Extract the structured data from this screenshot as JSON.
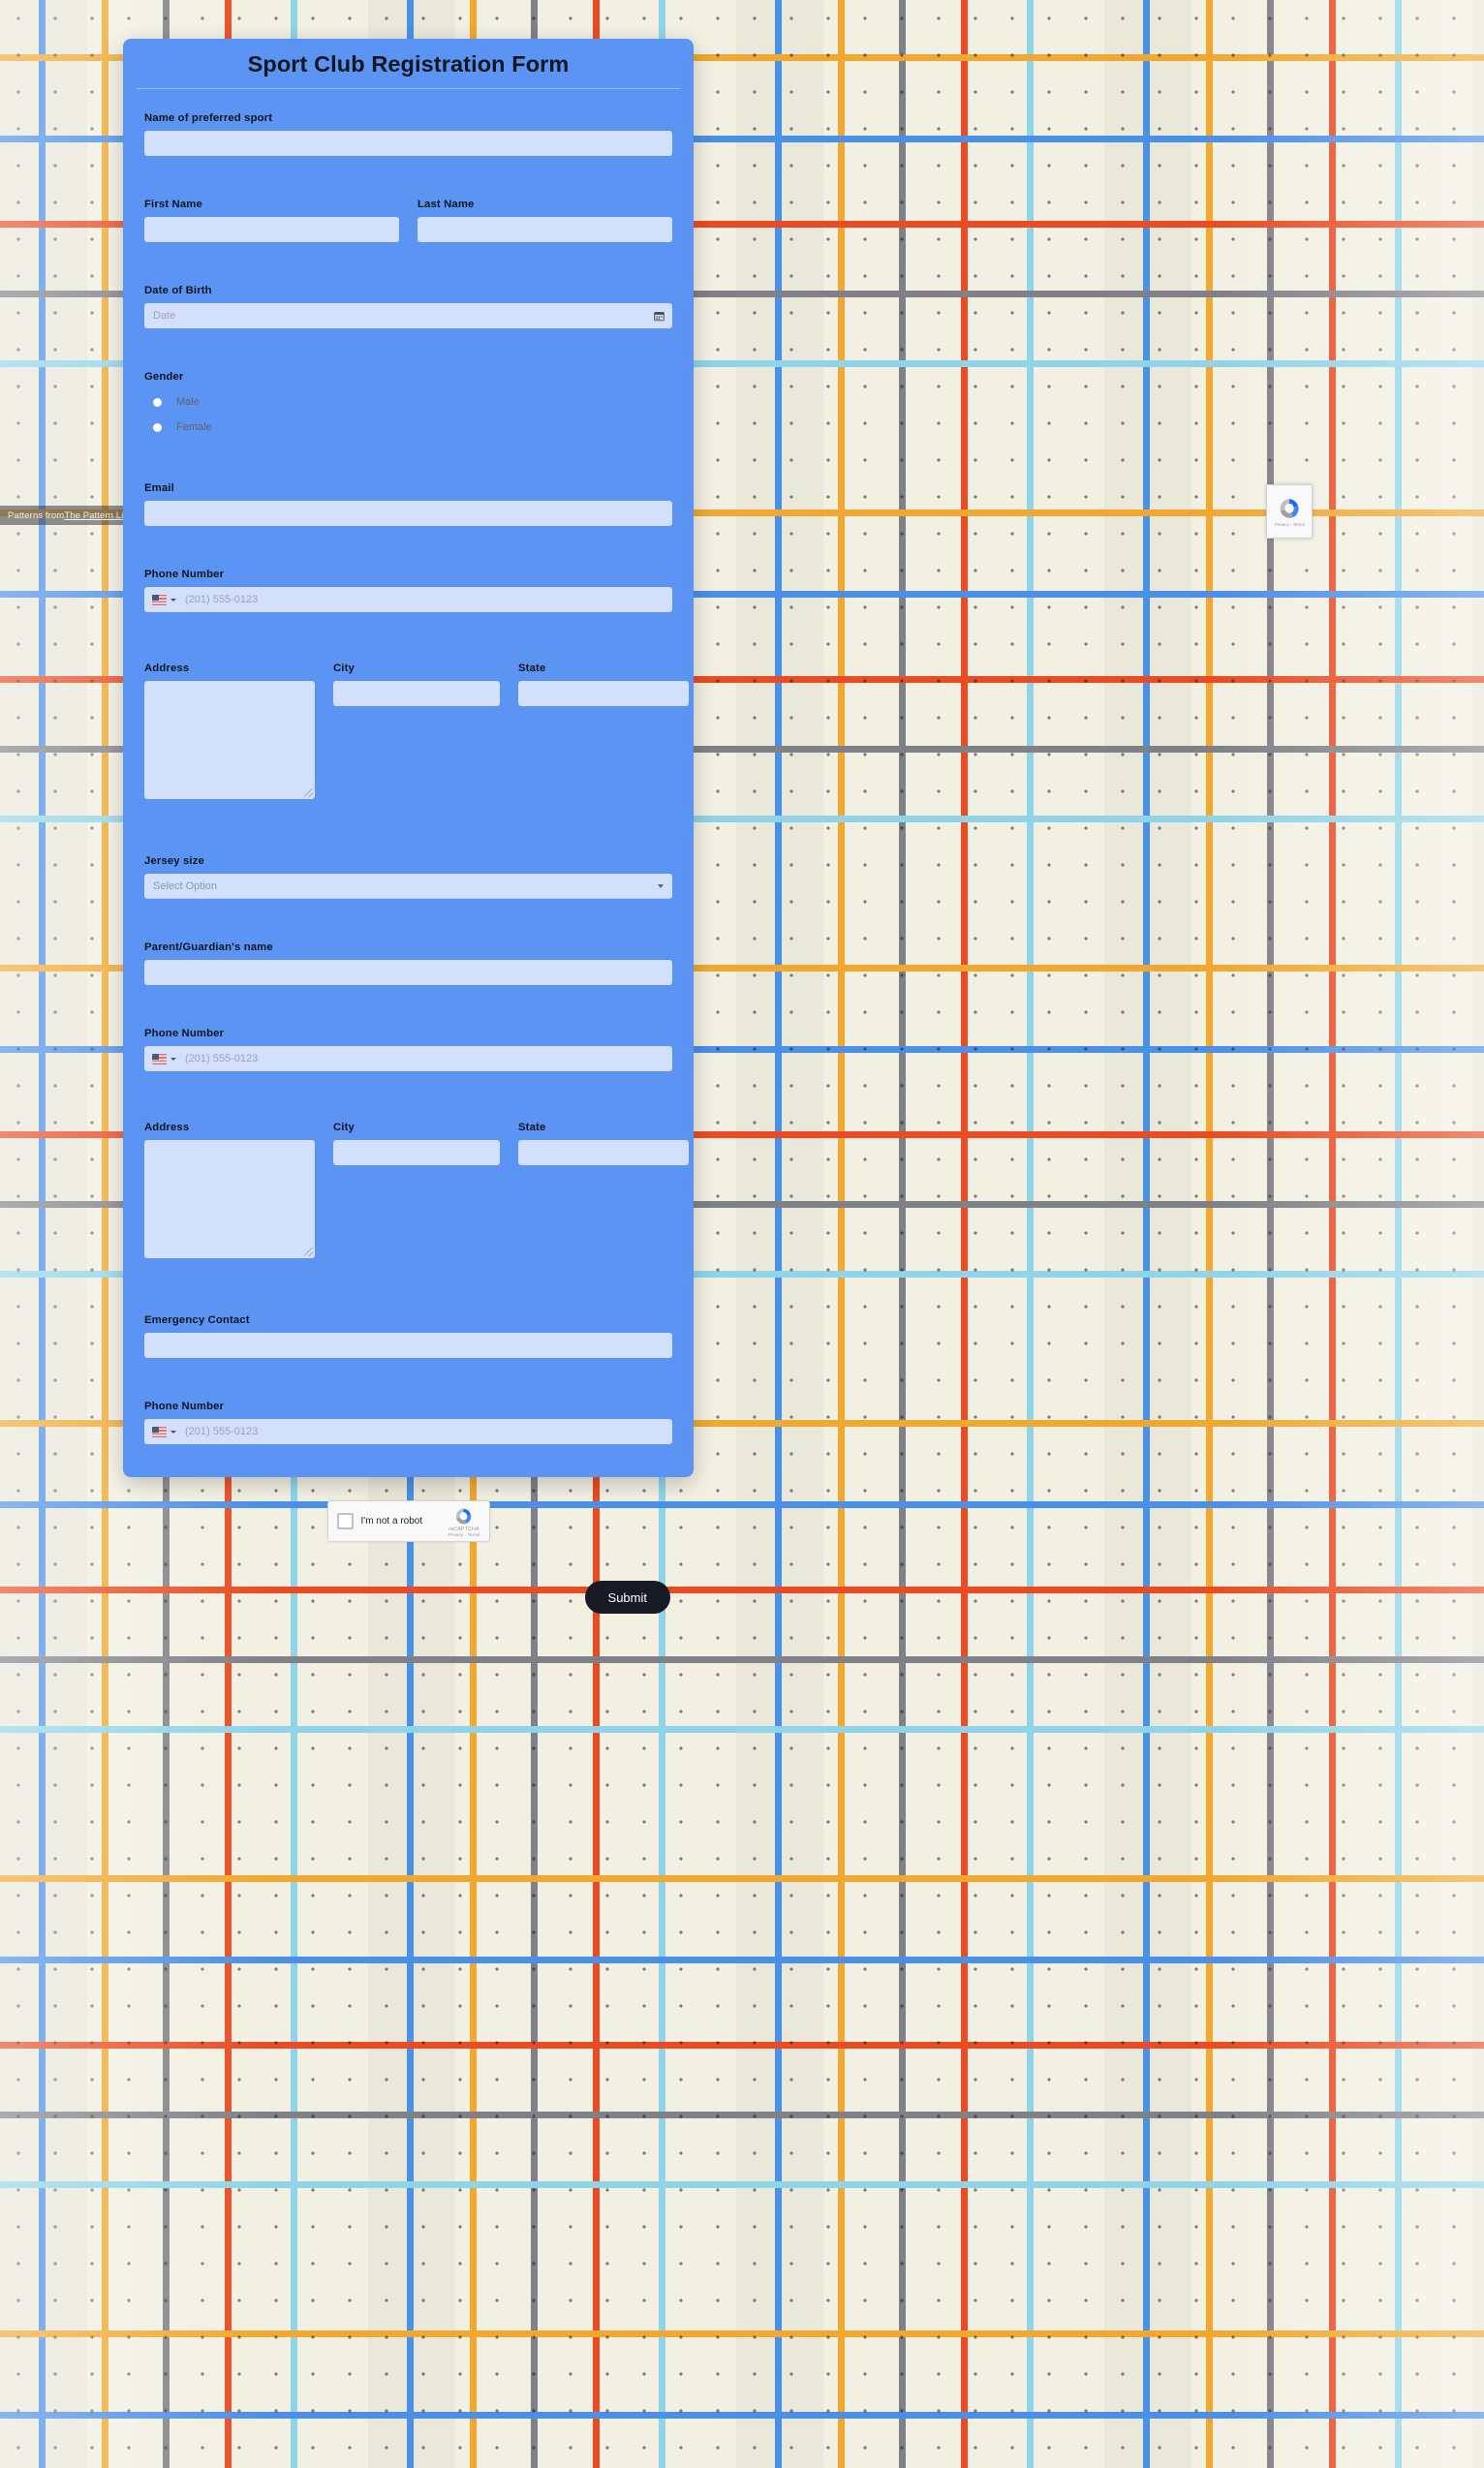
{
  "background": {
    "credit_prefix": "Patterns from ",
    "credit_link": "The Pattern Library",
    "colors": {
      "page_bg": "#f2f0e2",
      "line_orange": "#f0a830",
      "line_blue": "#4a8fe8",
      "line_red": "#eb4b22",
      "line_grey": "#7f8186",
      "line_cyan": "#8fd4e8"
    }
  },
  "floating_badge": {
    "icon": "recaptcha-icon",
    "privacy": "Privacy",
    "separator": "-",
    "terms": "Terms"
  },
  "form": {
    "title": "Sport Club Registration Form",
    "accent_color": "#5b94f2",
    "input_color": "#d3e0fb",
    "fields": {
      "preferred_sport": {
        "label": "Name of preferred sport",
        "value": "",
        "placeholder": ""
      },
      "first_name": {
        "label": "First Name",
        "value": "",
        "placeholder": ""
      },
      "last_name": {
        "label": "Last Name",
        "value": "",
        "placeholder": ""
      },
      "date_of_birth": {
        "label": "Date of Birth",
        "value": "",
        "placeholder": "Date",
        "icon": "calendar-icon"
      },
      "gender": {
        "label": "Gender",
        "options": [
          {
            "label": "Male",
            "selected": false
          },
          {
            "label": "Female",
            "selected": false
          }
        ]
      },
      "email": {
        "label": "Email",
        "value": "",
        "placeholder": ""
      },
      "phone_number": {
        "label": "Phone Number",
        "value": "",
        "placeholder": "(201) 555-0123",
        "country_flag": "us-flag-icon"
      },
      "address": {
        "label": "Address",
        "value": "",
        "placeholder": ""
      },
      "city": {
        "label": "City",
        "value": "",
        "placeholder": ""
      },
      "state": {
        "label": "State",
        "value": "",
        "placeholder": ""
      },
      "jersey_size": {
        "label": "Jersey size",
        "selected_option": "Select Option"
      },
      "guardian_name": {
        "label": "Parent/Guardian's name",
        "value": "",
        "placeholder": ""
      },
      "guardian_phone": {
        "label": "Phone Number",
        "value": "",
        "placeholder": "(201) 555-0123",
        "country_flag": "us-flag-icon"
      },
      "guardian_address": {
        "label": "Address",
        "value": "",
        "placeholder": ""
      },
      "guardian_city": {
        "label": "City",
        "value": "",
        "placeholder": ""
      },
      "guardian_state": {
        "label": "State",
        "value": "",
        "placeholder": ""
      },
      "emergency_contact": {
        "label": "Emergency Contact",
        "value": "",
        "placeholder": ""
      },
      "emergency_phone": {
        "label": "Phone Number",
        "value": "",
        "placeholder": "(201) 555-0123",
        "country_flag": "us-flag-icon"
      }
    },
    "captcha": {
      "label": "I'm not a robot",
      "brand": "reCAPTCHA",
      "privacy": "Privacy",
      "separator": "-",
      "terms": "Terms",
      "checked": false
    },
    "submit_label": "Submit"
  }
}
